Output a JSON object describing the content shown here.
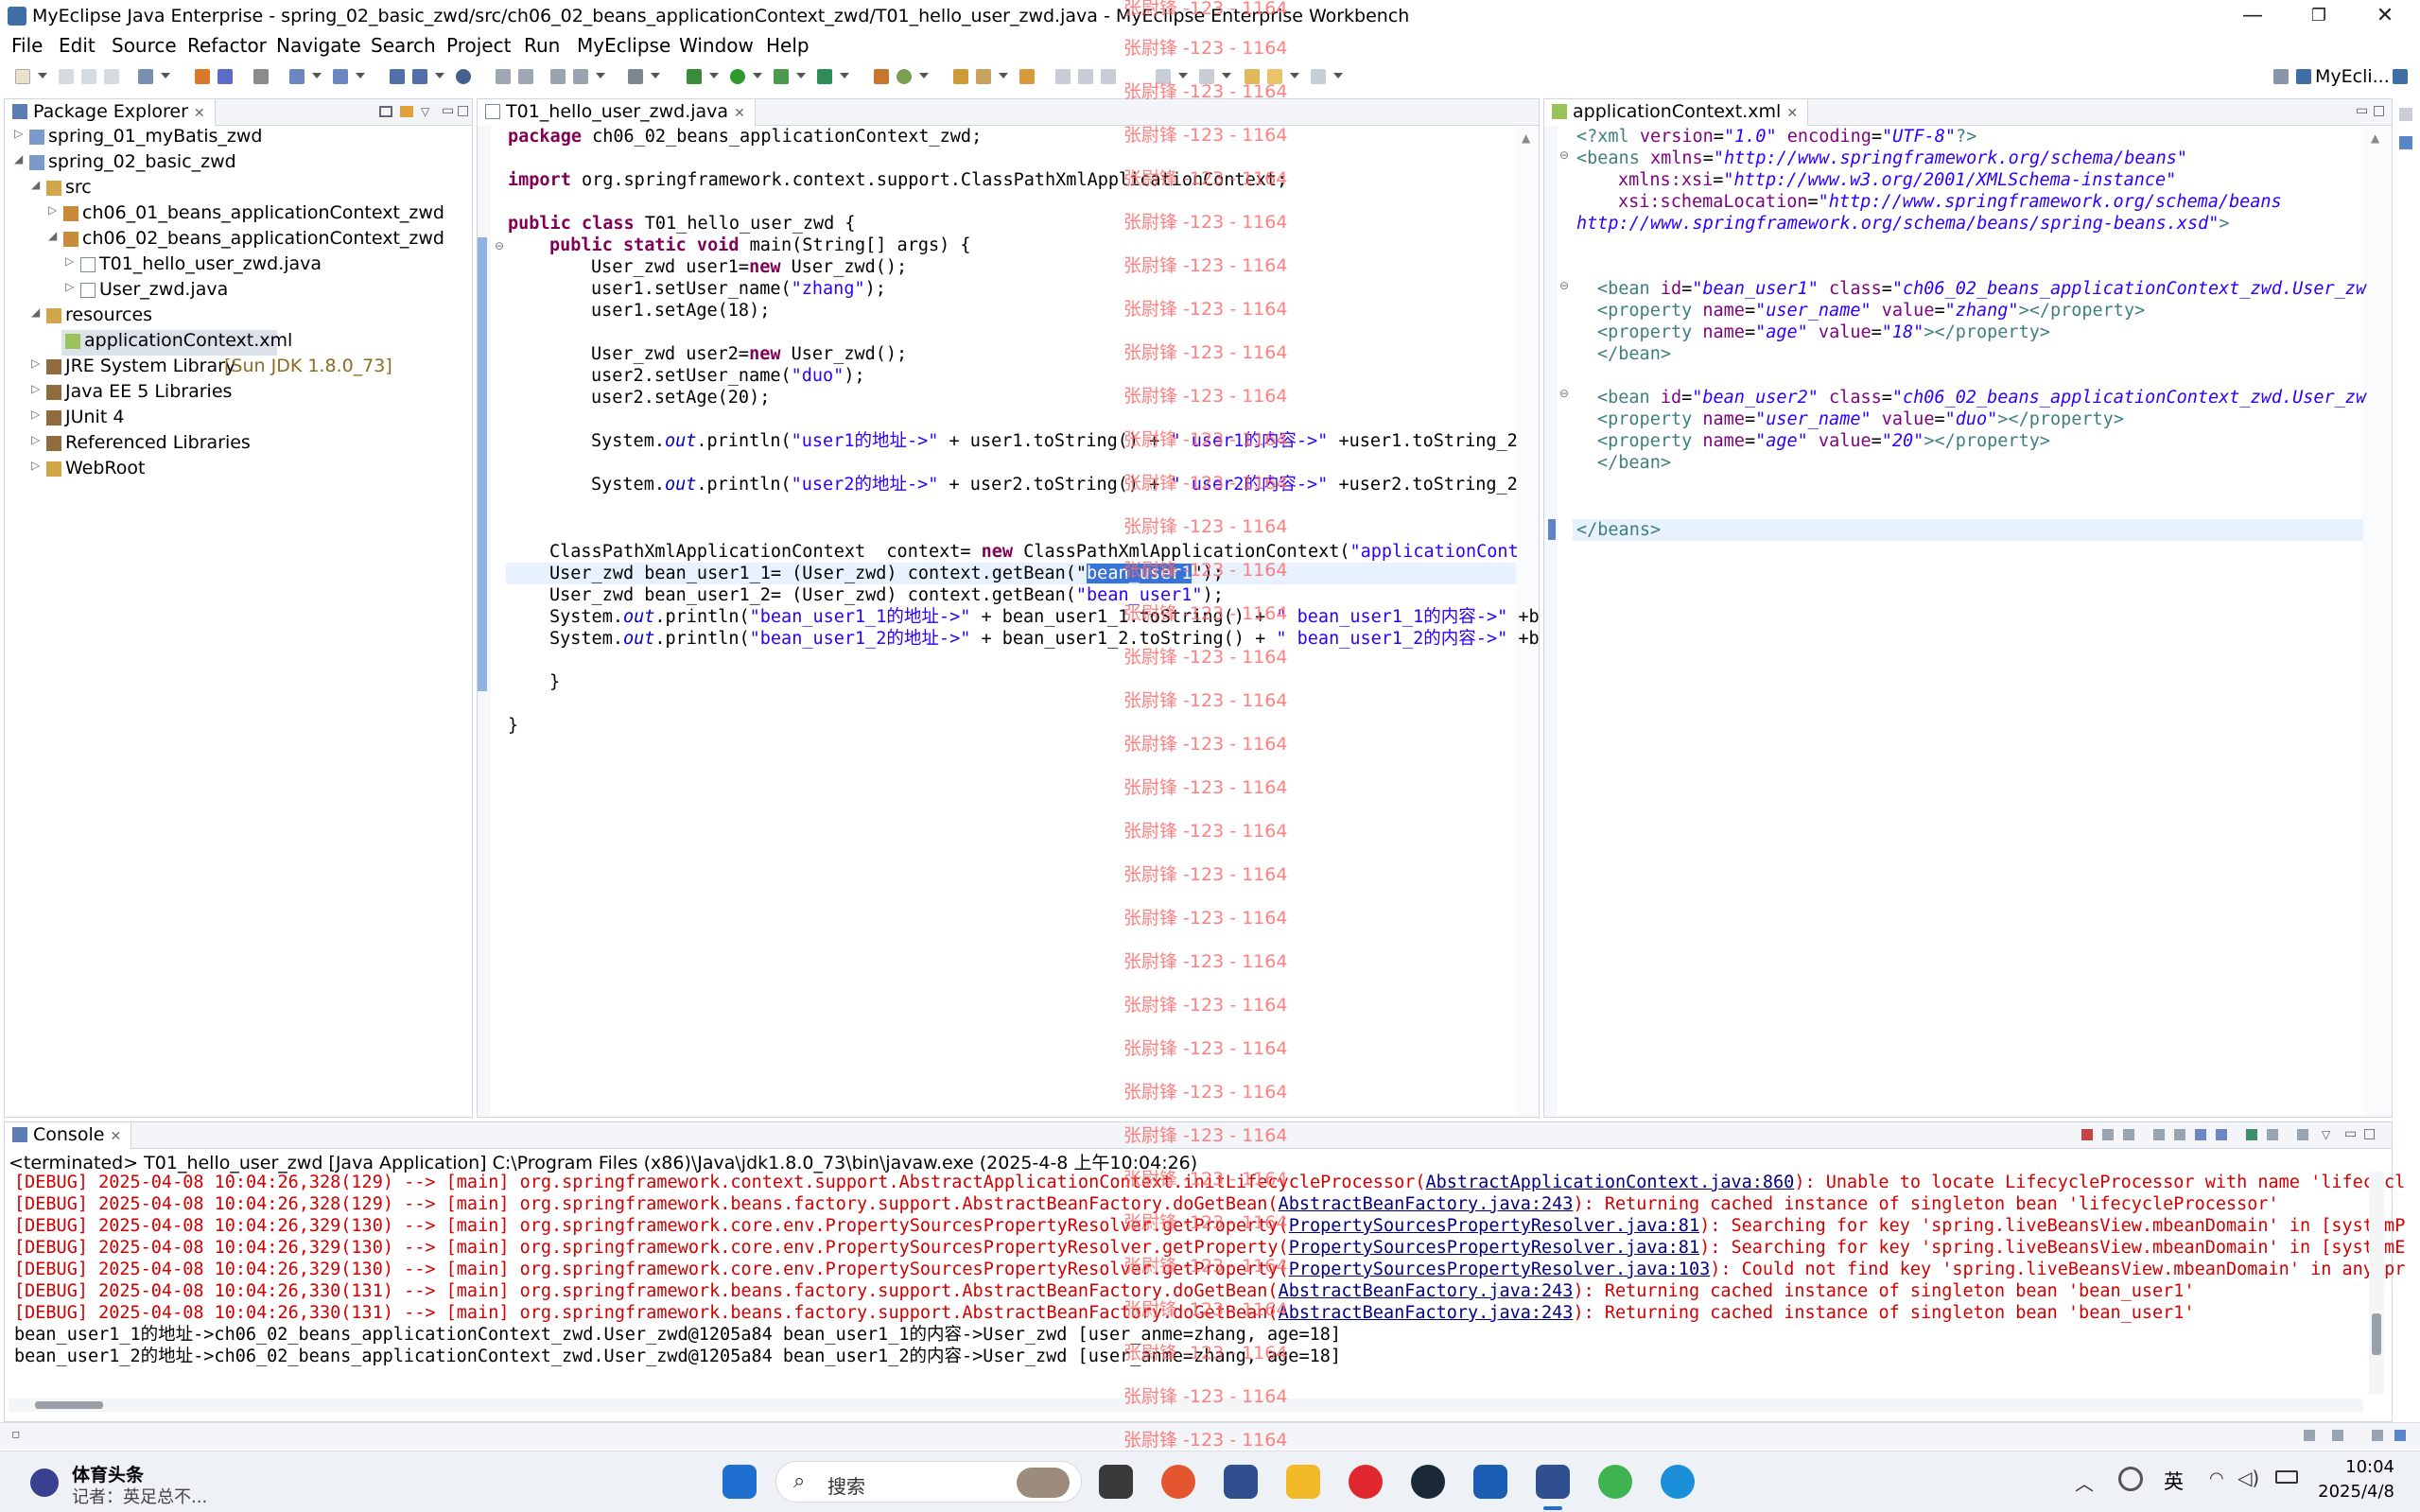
{
  "window": {
    "title": "MyEclipse Java Enterprise - spring_02_basic_zwd/src/ch06_02_beans_applicationContext_zwd/T01_hello_user_zwd.java - MyEclipse Enterprise Workbench",
    "minimize": "—",
    "restore": "❐",
    "close": "✕"
  },
  "menu": [
    "File",
    "Edit",
    "Source",
    "Refactor",
    "Navigate",
    "Search",
    "Project",
    "Run",
    "MyEclipse",
    "Window",
    "Help"
  ],
  "perspective_label": "MyEcli...",
  "package_explorer": {
    "tab": "Package Explorer",
    "items": [
      {
        "label": "spring_01_myBatis_zwd",
        "extra": ""
      },
      {
        "label": "spring_02_basic_zwd",
        "extra": ""
      },
      {
        "label": "src",
        "extra": ""
      },
      {
        "label": "ch06_01_beans_applicationContext_zwd",
        "extra": ""
      },
      {
        "label": "ch06_02_beans_applicationContext_zwd",
        "extra": ""
      },
      {
        "label": "T01_hello_user_zwd.java",
        "extra": ""
      },
      {
        "label": "User_zwd.java",
        "extra": ""
      },
      {
        "label": "resources",
        "extra": ""
      },
      {
        "label": "applicationContext.xml",
        "extra": ""
      },
      {
        "label": "JRE System Library",
        "extra": "[Sun JDK 1.8.0_73]"
      },
      {
        "label": "Java EE 5 Libraries",
        "extra": ""
      },
      {
        "label": "JUnit 4",
        "extra": ""
      },
      {
        "label": "Referenced Libraries",
        "extra": ""
      },
      {
        "label": "WebRoot",
        "extra": ""
      }
    ]
  },
  "java_editor": {
    "tab": "T01_hello_user_zwd.java",
    "lines": {
      "l1": "package ch06_02_beans_applicationContext_zwd;",
      "l3a": "import",
      "l3b": " org.springframework.context.support.ClassPathXmlApplicationContext;",
      "l5a": "public class",
      "l5b": " T01_hello_user_zwd {",
      "l6a": "public static void",
      "l6b": " main(String[] args) {",
      "l7a": "User_zwd user1=",
      "l7b": "new",
      "l7c": " User_zwd();",
      "l8a": "user1.setUser_name(",
      "l8b": "\"zhang\"",
      "l8c": ");",
      "l9": "user1.setAge(18);",
      "l11a": "User_zwd user2=",
      "l11b": "new",
      "l11c": " User_zwd();",
      "l12a": "user2.setUser_name(",
      "l12b": "\"duo\"",
      "l12c": ");",
      "l13": "user2.setAge(20);",
      "l15a": "System.",
      "l15b": "out",
      "l15c": ".println(",
      "l15d": "\"user1的地址->\"",
      "l15e": " + user1.toString() + ",
      "l15f": "\" user1的内容->\"",
      "l15g": " +user1.toString_2",
      "l17a": "System.",
      "l17b": "out",
      "l17c": ".println(",
      "l17d": "\"user2的地址->\"",
      "l17e": " + user2.toString() + ",
      "l17f": "\" user2的内容->\"",
      "l17g": " +user2.toString_2",
      "l20a": "ClassPathXmlApplicationContext  context= ",
      "l20b": "new",
      "l20c": " ClassPathXmlApplicationContext(",
      "l20d": "\"applicationCont",
      "l21a": "User_zwd bean_user1_1= (User_zwd) context.getBean(\"",
      "l21b": "bean_user1",
      "l21c": "\");",
      "l22a": "User_zwd bean_user1_2= (User_zwd) context.getBean(",
      "l22b": "\"bean_user1\"",
      "l22c": ");",
      "l23a": "System.",
      "l23b": "out",
      "l23c": ".println(",
      "l23d": "\"bean_user1_1的地址->\"",
      "l23e": " + bean_user1_1.toString() + ",
      "l23f": "\" bean_user1_1的内容->\"",
      "l23g": " +b",
      "l24a": "System.",
      "l24b": "out",
      "l24c": ".println(",
      "l24d": "\"bean_user1_2的地址->\"",
      "l24e": " + bean_user1_2.toString() + ",
      "l24f": "\" bean_user1_2的内容->\"",
      "l24g": " +b",
      "l26": "}",
      "l28": "}"
    }
  },
  "xml_editor": {
    "tab": "applicationContext.xml",
    "lines": {
      "x1a": "<?xml ",
      "x1b": "version",
      "x1c": "=",
      "x1d": "\"1.0\"",
      "x1e": " encoding",
      "x1f": "\"UTF-8\"",
      "x1g": "?>",
      "x2a": "<beans ",
      "x2b": "xmlns",
      "x2c": "\"http://www.springframework.org/schema/beans\"",
      "x3b": "xmlns:xsi",
      "x3c": "\"http://www.w3.org/2001/XMLSchema-instance\"",
      "x4b": "xsi:schemaLocation",
      "x4c": "\"http://www.springframework.org/schema/beans",
      "x5": "http://www.springframework.org/schema/beans/spring-beans.xsd\"",
      "x5g": ">",
      "b1a": "<bean ",
      "b1b": "id",
      "b1c": "\"bean_user1\"",
      "b1d": " class",
      "b1e": "\"ch06_02_beans_applicationContext_zwd.User_zw",
      "p1a": "<property ",
      "p1b": "name",
      "p1c": "\"user_name\"",
      "p1d": " value",
      "p1e": "\"zhang\"",
      "p1f": "></property>",
      "p2c": "\"age\"",
      "p2e": "\"18\"",
      "bend": "</bean>",
      "b2c": "\"bean_user2\"",
      "p3e": "\"duo\"",
      "p4e": "\"20\"",
      "beans_end": "</beans>"
    }
  },
  "console": {
    "tab": "Console",
    "header": "<terminated> T01_hello_user_zwd [Java Application] C:\\Program Files (x86)\\Java\\jdk1.8.0_73\\bin\\javaw.exe (2025-4-8 上午10:04:26)",
    "debug": [
      {
        "pre": "[DEBUG] 2025-04-08 10:04:26,328(129) --> [main] org.springframework.context.support.AbstractApplicationContext.initLifecycleProcessor(",
        "link": "AbstractApplicationContext.java:860",
        "post": "): Unable to locate LifecycleProcessor with name 'lifecycl"
      },
      {
        "pre": "[DEBUG] 2025-04-08 10:04:26,328(129) --> [main] org.springframework.beans.factory.support.AbstractBeanFactory.doGetBean(",
        "link": "AbstractBeanFactory.java:243",
        "post": "): Returning cached instance of singleton bean 'lifecycleProcessor'"
      },
      {
        "pre": "[DEBUG] 2025-04-08 10:04:26,329(130) --> [main] org.springframework.core.env.PropertySourcesPropertyResolver.getProperty(",
        "link": "PropertySourcesPropertyResolver.java:81",
        "post": "): Searching for key 'spring.liveBeansView.mbeanDomain' in [systemP"
      },
      {
        "pre": "[DEBUG] 2025-04-08 10:04:26,329(130) --> [main] org.springframework.core.env.PropertySourcesPropertyResolver.getProperty(",
        "link": "PropertySourcesPropertyResolver.java:81",
        "post": "): Searching for key 'spring.liveBeansView.mbeanDomain' in [systemE"
      },
      {
        "pre": "[DEBUG] 2025-04-08 10:04:26,329(130) --> [main] org.springframework.core.env.PropertySourcesPropertyResolver.getProperty(",
        "link": "PropertySourcesPropertyResolver.java:103",
        "post": "): Could not find key 'spring.liveBeansView.mbeanDomain' in any pr"
      },
      {
        "pre": "[DEBUG] 2025-04-08 10:04:26,330(131) --> [main] org.springframework.beans.factory.support.AbstractBeanFactory.doGetBean(",
        "link": "AbstractBeanFactory.java:243",
        "post": "): Returning cached instance of singleton bean 'bean_user1'"
      },
      {
        "pre": "[DEBUG] 2025-04-08 10:04:26,330(131) --> [main] org.springframework.beans.factory.support.AbstractBeanFactory.doGetBean(",
        "link": "AbstractBeanFactory.java:243",
        "post": "): Returning cached instance of singleton bean 'bean_user1'"
      }
    ],
    "out": [
      "bean_user1_1的地址->ch06_02_beans_applicationContext_zwd.User_zwd@1205a84 bean_user1_1的内容->User_zwd [user_anme=zhang, age=18]",
      "bean_user1_2的地址->ch06_02_beans_applicationContext_zwd.User_zwd@1205a84 bean_user1_2的内容->User_zwd [user_anme=zhang, age=18]"
    ]
  },
  "watermark": "张尉锋 -123 - 1164",
  "taskbar": {
    "news_title": "体育头条",
    "news_sub": "记者：英足总不...",
    "search_label": "搜索",
    "ime": "英",
    "time": "10:04",
    "date": "2025/4/8"
  },
  "colors": {
    "keyword": "#7f0055",
    "string": "#2a00ff",
    "debug": "#d20000",
    "watermark": "#ff6a6a",
    "selection": "#3874d8"
  }
}
